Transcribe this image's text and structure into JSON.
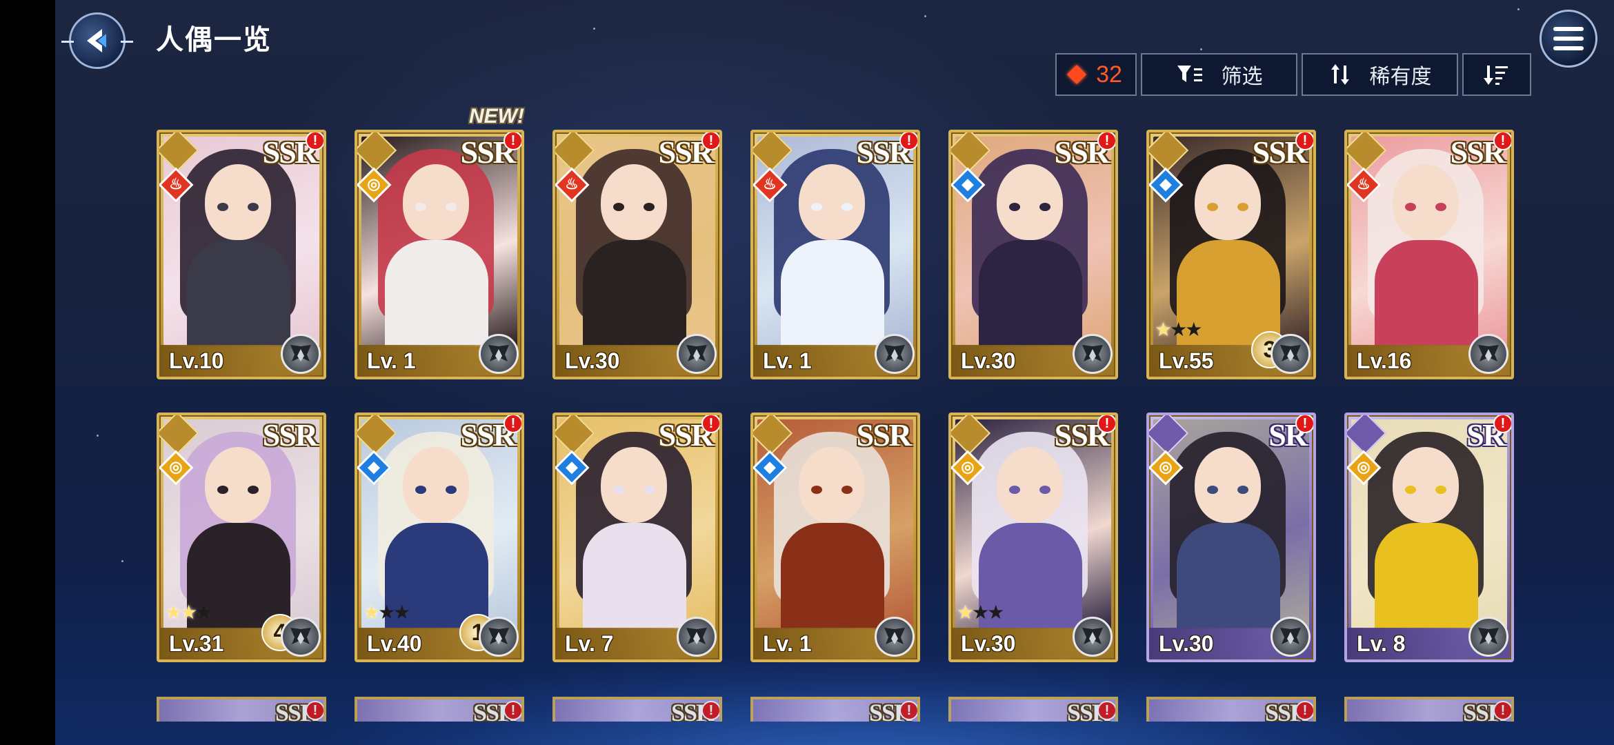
{
  "header": {
    "title": "人偶一览"
  },
  "toolbar": {
    "count": "32",
    "filter_label": "筛选",
    "sort_label": "稀有度",
    "sort_direction_icon": "sort-descending-icon"
  },
  "cards": [
    {
      "rarity": "SSR",
      "element": "fire",
      "level": "Lv.10",
      "alert": "!"
    },
    {
      "rarity": "SSR",
      "element": "light",
      "level": "Lv. 1",
      "alert": "!",
      "tag": "NEW!"
    },
    {
      "rarity": "SSR",
      "element": "fire",
      "level": "Lv.30",
      "alert": "!"
    },
    {
      "rarity": "SSR",
      "element": "fire",
      "level": "Lv. 1",
      "alert": "!"
    },
    {
      "rarity": "SSR",
      "element": "water",
      "level": "Lv.30",
      "alert": "!"
    },
    {
      "rarity": "SSR",
      "element": "water",
      "level": "Lv.55",
      "alert": "!",
      "limit_break": "3",
      "stars": 1
    },
    {
      "rarity": "SSR",
      "element": "fire",
      "level": "Lv.16",
      "alert": "!"
    },
    {
      "rarity": "SSR",
      "element": "light",
      "level": "Lv.31",
      "limit_break": "4",
      "stars": 2
    },
    {
      "rarity": "SSR",
      "element": "water",
      "level": "Lv.40",
      "alert": "!",
      "limit_break": "1",
      "stars": 1
    },
    {
      "rarity": "SSR",
      "element": "water",
      "level": "Lv. 7",
      "alert": "!"
    },
    {
      "rarity": "SSR",
      "element": "water",
      "level": "Lv. 1"
    },
    {
      "rarity": "SSR",
      "element": "light",
      "level": "Lv.30",
      "alert": "!",
      "stars": 1
    },
    {
      "rarity": "SR",
      "element": "light",
      "level": "Lv.30",
      "alert": "!"
    },
    {
      "rarity": "SR",
      "element": "light",
      "level": "Lv. 8",
      "alert": "!"
    }
  ],
  "peek_row": [
    {
      "rarity": "SSR",
      "alert": "!"
    },
    {
      "rarity": "SSR",
      "alert": "!"
    },
    {
      "rarity": "SSR",
      "alert": "!"
    },
    {
      "rarity": "SSR",
      "alert": "!"
    },
    {
      "rarity": "SSR",
      "alert": "!"
    },
    {
      "rarity": "SSR",
      "alert": "!"
    },
    {
      "rarity": "SSR",
      "alert": "!"
    }
  ],
  "colors": {
    "accent_count": "#ff5a2a",
    "ssr_frame": "#d8b454",
    "sr_frame": "#b5a4e3",
    "alert": "#e01818"
  }
}
